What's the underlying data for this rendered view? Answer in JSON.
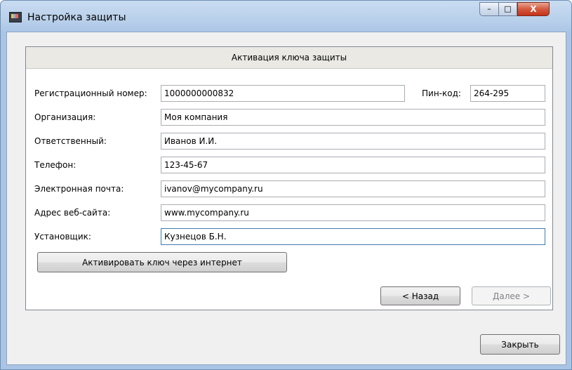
{
  "window": {
    "title": "Настройка защиты",
    "icon": "app-icon",
    "controls": {
      "minimize": "–",
      "maximize": "□",
      "close": "X"
    }
  },
  "panel": {
    "header": "Активация ключа защиты",
    "fields": {
      "reg_number": {
        "label": "Регистрационный номер:",
        "value": "1000000000832"
      },
      "pin": {
        "label": "Пин-код:",
        "value": "264-295"
      },
      "organization": {
        "label": "Организация:",
        "value": "Моя компания"
      },
      "responsible": {
        "label": "Ответственный:",
        "value": "Иванов И.И."
      },
      "phone": {
        "label": "Телефон:",
        "value": "123-45-67"
      },
      "email": {
        "label": "Электронная почта:",
        "value": "ivanov@mycompany.ru"
      },
      "website": {
        "label": "Адрес веб-сайта:",
        "value": "www.mycompany.ru"
      },
      "installer": {
        "label": "Установщик:",
        "value": "Кузнецов Б.Н."
      }
    },
    "activate_button": "Активировать ключ через интернет",
    "back_button": "< Назад",
    "next_button": "Далее >"
  },
  "footer": {
    "close_button": "Закрыть"
  },
  "colors": {
    "focus_border": "#3d7bad",
    "close_button_red": "#c2341a",
    "frame_blue": "#b7cfea"
  }
}
